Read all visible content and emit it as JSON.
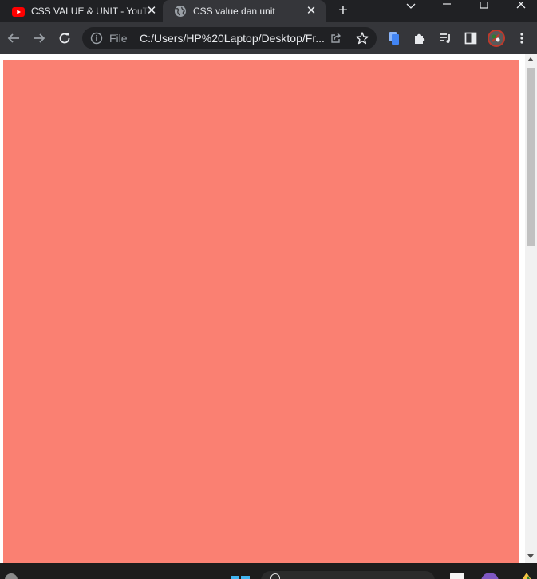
{
  "tabs": [
    {
      "title": "CSS VALUE & UNIT - YouTube",
      "favicon": "youtube-icon",
      "active": false
    },
    {
      "title": "CSS value dan unit",
      "favicon": "globe-icon",
      "active": true
    }
  ],
  "omnibox": {
    "security_label": "File",
    "url": "C:/Users/HP%20Laptop/Desktop/Fr..."
  },
  "page": {
    "box_color": "#fa8072",
    "background": "#ffffff"
  },
  "colors": {
    "tabstrip": "#202124",
    "toolbar": "#35363a",
    "text": "#e8eaed",
    "youtube_red": "#ff0000"
  }
}
